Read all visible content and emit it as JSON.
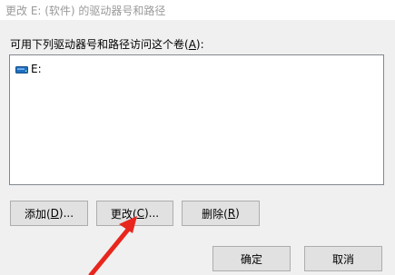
{
  "window": {
    "title": "更改 E: (软件) 的驱动器号和路径"
  },
  "prompt": {
    "text_before": "可用下列驱动器号和路径访问这个卷(",
    "hotkey": "A",
    "text_after": "):"
  },
  "list": {
    "items": [
      {
        "label": "E:",
        "icon": "drive-icon"
      }
    ]
  },
  "buttons": {
    "add": {
      "text": "添加(",
      "hotkey": "D",
      "suffix": ")..."
    },
    "change": {
      "text": "更改(",
      "hotkey": "C",
      "suffix": ")..."
    },
    "delete": {
      "text": "删除(",
      "hotkey": "R",
      "suffix": ")"
    },
    "ok": "确定",
    "cancel": "取消"
  },
  "colors": {
    "annotation_arrow": "#e8261d",
    "drive_icon": "#1f6fbf"
  }
}
